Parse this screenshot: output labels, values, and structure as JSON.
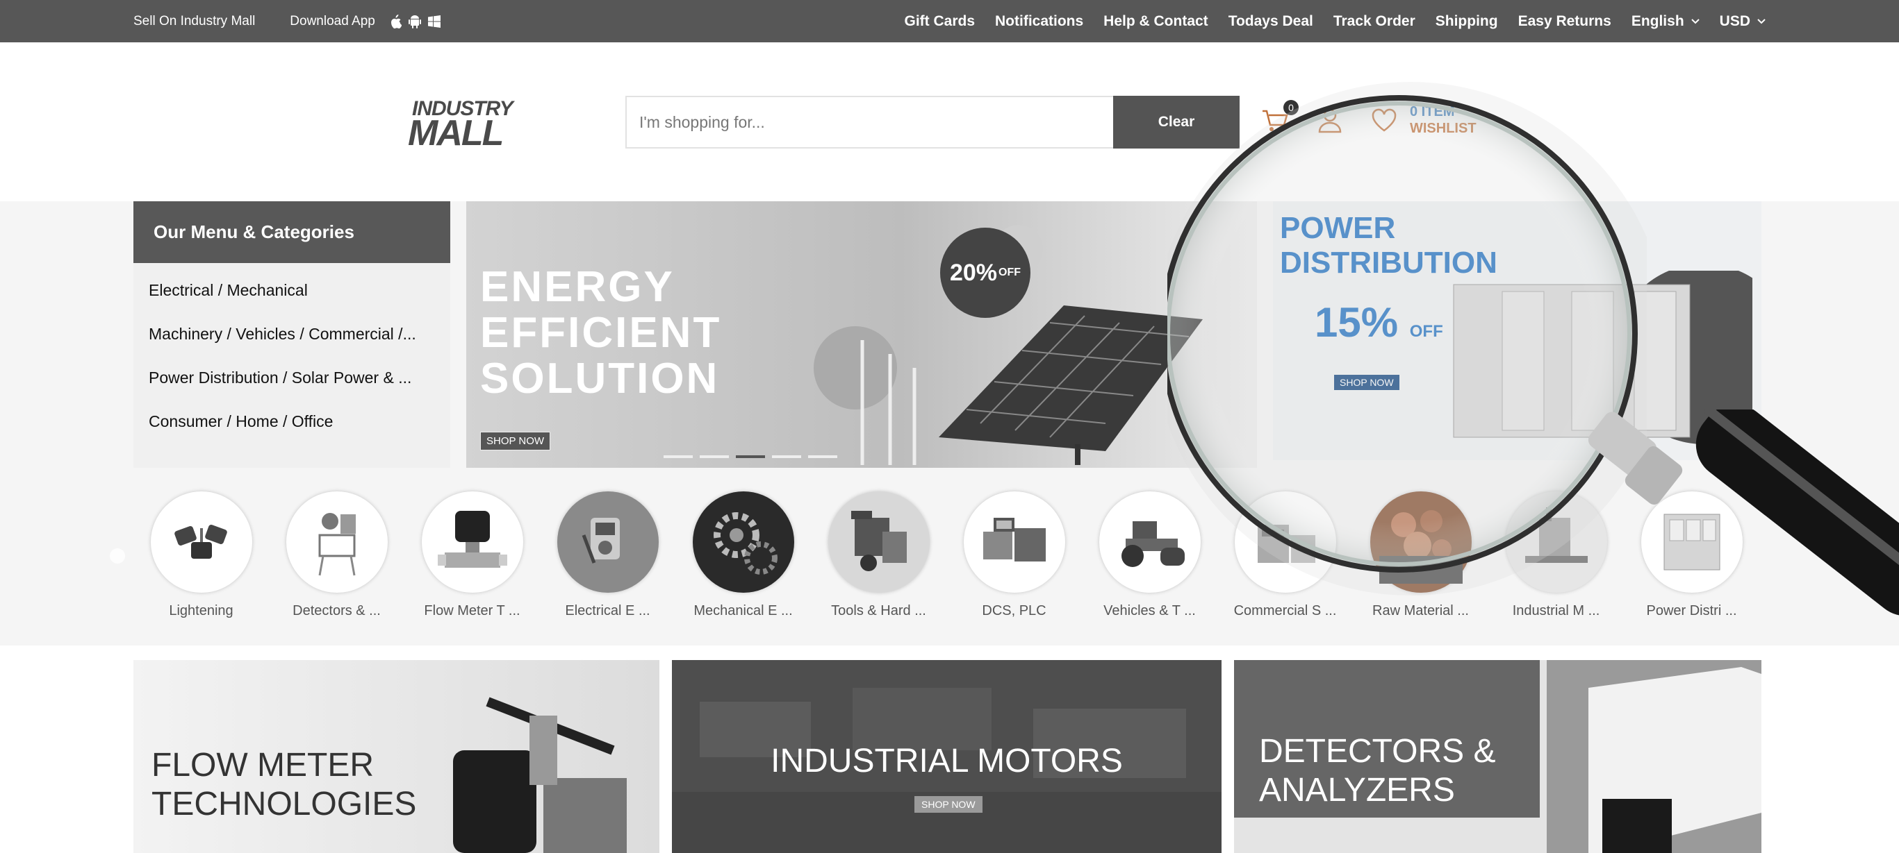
{
  "topbar": {
    "sell_label": "Sell On Industry Mall",
    "download_label": "Download App",
    "app_icons": [
      "apple-icon",
      "android-icon",
      "windows-icon"
    ],
    "nav": [
      "Gift Cards",
      "Notifications",
      "Help & Contact",
      "Todays Deal",
      "Track Order",
      "Shipping",
      "Easy Returns"
    ],
    "language": "English",
    "currency": "USD"
  },
  "header": {
    "logo_line1": "INDUSTRY",
    "logo_line2": "MALL",
    "search_placeholder": "I'm shopping for...",
    "search_button": "Clear",
    "cart_count": "0",
    "wishlist_count": "0 ITEM",
    "wishlist_label": "WISHLIST"
  },
  "menu": {
    "title": "Our Menu & Categories",
    "items": [
      "Electrical / Mechanical",
      "Machinery / Vehicles / Commercial /...",
      "Power Distribution / Solar Power & ...",
      "Consumer / Home / Office"
    ]
  },
  "banner": {
    "line1": "ENERGY",
    "line2": "EFFICIENT",
    "line3": "SOLUTION",
    "discount": "20%",
    "discount_suffix": "OFF",
    "shop_label": "SHOP NOW"
  },
  "promo": {
    "line1": "POWER",
    "line2": "DISTRIBUTION",
    "discount": "15%",
    "discount_suffix": "OFF",
    "shop_label": "SHOP NOW"
  },
  "categories": [
    "Lightening",
    "Detectors & ...",
    "Flow Meter T ...",
    "Electrical E ...",
    "Mechanical E ...",
    "Tools & Hard ...",
    "DCS, PLC",
    "Vehicles & T ...",
    "Commercial S ...",
    "Raw Material ...",
    "Industrial M ...",
    "Power Distri ..."
  ],
  "tiles": {
    "t1_line1": "FLOW METER",
    "t1_line2": "TECHNOLOGIES",
    "t2_title": "INDUSTRIAL MOTORS",
    "t2_shop": "SHOP NOW",
    "t3_line1": "DETECTORS &",
    "t3_line2": "ANALYZERS"
  }
}
